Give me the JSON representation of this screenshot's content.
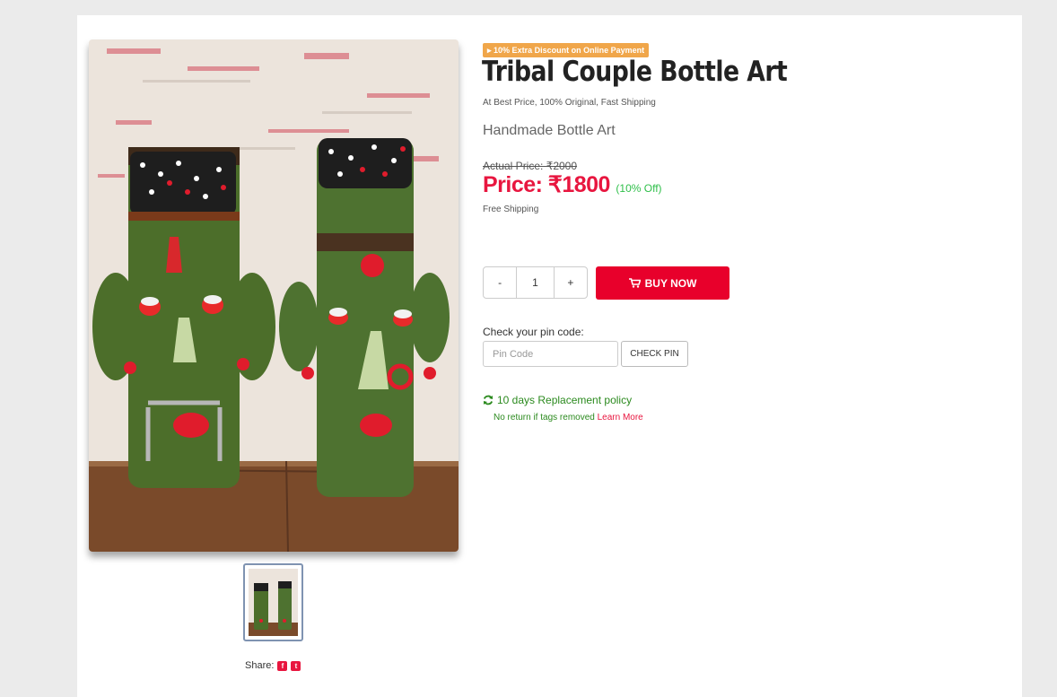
{
  "product": {
    "badge": "10% Extra Discount on Online Payment",
    "title": "Tribal Couple Bottle Art",
    "subtitle": "At Best Price, 100% Original, Fast Shipping",
    "category": "Handmade Bottle Art",
    "actual_price": "Actual Price: ₹2000",
    "price": "Price: ₹1800",
    "discount": "(10% Off)",
    "shipping": "Free Shipping"
  },
  "quantity": {
    "decrement": "-",
    "value": "1",
    "increment": "+"
  },
  "buy_button": {
    "label": "BUY NOW"
  },
  "pincode": {
    "label": "Check your pin code:",
    "placeholder": "Pin Code",
    "button": "CHECK PIN"
  },
  "policy": {
    "title": "10 days Replacement policy",
    "note": "No return if tags removed",
    "link": "Learn More"
  },
  "share": {
    "label": "Share:"
  },
  "icons": {
    "badge": "tag-icon",
    "buy": "cart-icon",
    "policy": "refresh-icon",
    "share": [
      "facebook-icon",
      "twitter-icon"
    ]
  },
  "colors": {
    "accent": "#e8002b",
    "badge": "#f0a64a",
    "discount": "#2fbf4a",
    "policy": "#2b8a1e"
  }
}
